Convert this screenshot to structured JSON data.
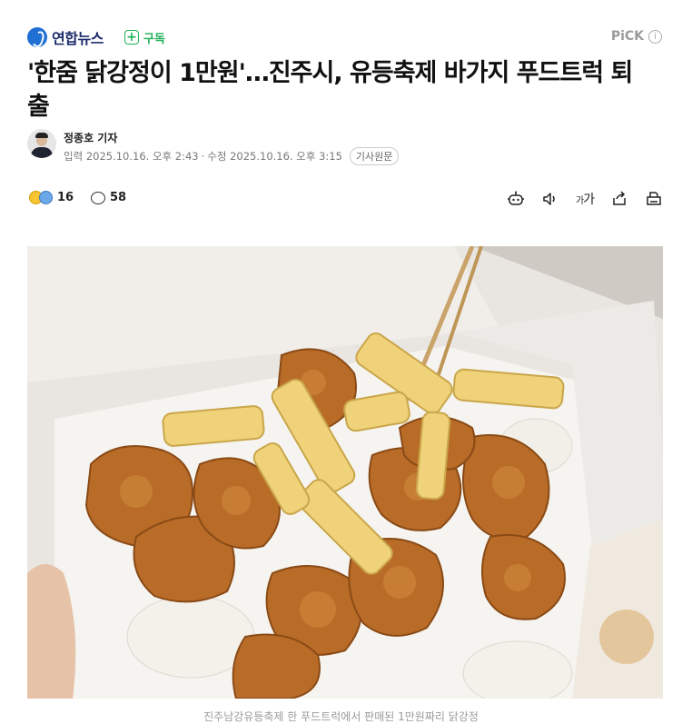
{
  "header": {
    "logo_text": "연합뉴스",
    "subscribe_label": "구독",
    "pick_label": "PiCK",
    "info_glyph": "i"
  },
  "article": {
    "title": "'한줌 닭강정이 1만원'…진주시, 유등축제 바가지 푸드트럭 퇴출",
    "reporter": "정종호 기자",
    "published": "입력 2025.10.16. 오후 2:43",
    "separator": "·",
    "modified": "수정 2025.10.16. 오후 3:15",
    "original_button": "기사원문"
  },
  "actions": {
    "reaction_count": "16",
    "comment_count": "58",
    "fontsize_glyph_small": "가",
    "fontsize_glyph_large": "가",
    "icons": [
      "robot-summary-icon",
      "speaker-icon",
      "font-size-icon",
      "share-icon",
      "print-icon"
    ]
  },
  "photo": {
    "subject": "chicken-gangjeong-box-image"
  },
  "caption": "진주남강유등축제 한 푸드트럭에서 판매된 1만원짜리 닭강정"
}
